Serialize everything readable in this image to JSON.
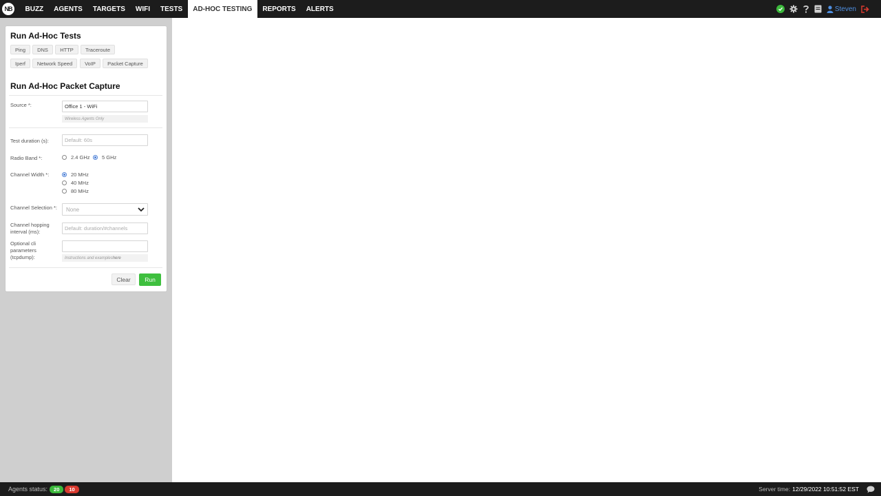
{
  "nav": {
    "logo": "NB",
    "items": [
      "BUZZ",
      "AGENTS",
      "TARGETS",
      "WIFI",
      "TESTS",
      "AD-HOC TESTING",
      "REPORTS",
      "ALERTS"
    ],
    "active_index": 5,
    "user": "Steven",
    "icons": [
      "check-circle-icon",
      "gear-icon",
      "help-icon",
      "book-icon",
      "user-icon",
      "logout-icon"
    ]
  },
  "panel": {
    "title": "Run Ad-Hoc Tests",
    "test_buttons_row1": [
      "Ping",
      "DNS",
      "HTTP",
      "Traceroute"
    ],
    "test_buttons_row2": [
      "Iperf",
      "Network Speed",
      "VoIP",
      "Packet Capture"
    ],
    "subtitle": "Run Ad-Hoc Packet Capture",
    "source_label": "Source *:",
    "source_value": "Office 1 - WiFi",
    "source_hint": "Wireless Agents Only",
    "duration_label": "Test duration (s):",
    "duration_placeholder": "Default: 60s",
    "radio_band_label": "Radio Band *:",
    "radio_band_options": [
      "2.4 GHz",
      "5 GHz"
    ],
    "radio_band_selected": "5 GHz",
    "channel_width_label": "Channel Width *:",
    "channel_width_options": [
      "20 MHz",
      "40 MHz",
      "80 MHz"
    ],
    "channel_width_selected": "20 MHz",
    "channel_selection_label": "Channel Selection *:",
    "channel_selection_value": "None",
    "hopping_label_1": "Channel hopping",
    "hopping_label_2": "interval (ms):",
    "hopping_placeholder": "Default: duration/#channels",
    "cli_label_1": "Optional cli",
    "cli_label_2": "parameters",
    "cli_label_3": "(tcpdump):",
    "cli_hint_prefix": "Instructions and examples ",
    "cli_hint_link": "here",
    "clear_label": "Clear",
    "run_label": "Run"
  },
  "footer": {
    "agents_label": "Agents status:",
    "agents_ok": "20",
    "agents_error": "10",
    "server_time_label": "Server time:",
    "server_time_value": "12/29/2022 10:51:52 EST"
  },
  "colors": {
    "nav_bg": "#1c1c1c",
    "sidebar_bg": "#cfcfcf",
    "run_green": "#3ebf3e",
    "status_red": "#d93a2f",
    "radio_blue": "#4a7fd6"
  }
}
